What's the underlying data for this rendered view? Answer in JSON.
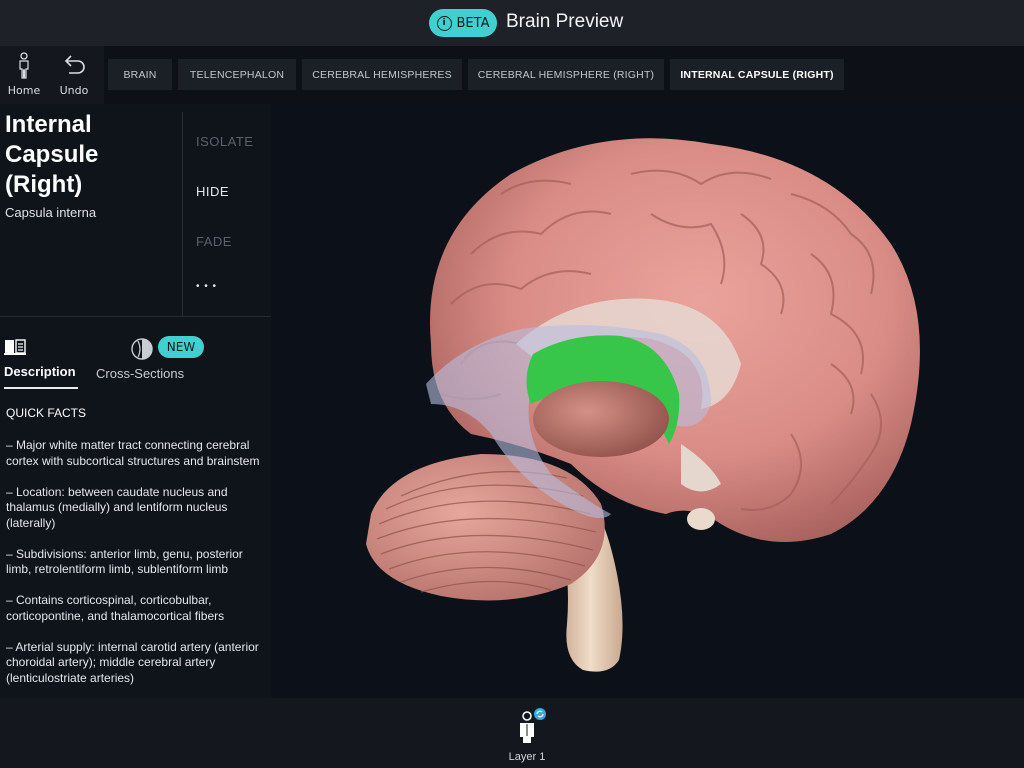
{
  "header": {
    "beta_label": "BETA",
    "title": "Brain Preview"
  },
  "tools": {
    "home_label": "Home",
    "undo_label": "Undo"
  },
  "breadcrumbs": [
    {
      "label": "BRAIN"
    },
    {
      "label": "TELENCEPHALON"
    },
    {
      "label": "CEREBRAL HEMISPHERES"
    },
    {
      "label": "CEREBRAL HEMISPHERE (RIGHT)"
    },
    {
      "label": "INTERNAL CAPSULE (RIGHT)",
      "active": true
    }
  ],
  "structure": {
    "title_line1": "Internal",
    "title_line2": "Capsule",
    "title_line3": "(Right)",
    "latin_name": "Capsula interna"
  },
  "actions": {
    "isolate": "ISOLATE",
    "hide": "HIDE",
    "fade": "FADE",
    "more": "• • •"
  },
  "tabs": {
    "description": "Description",
    "cross_sections": "Cross-Sections",
    "new_badge": "NEW"
  },
  "quick_facts": {
    "heading": "QUICK FACTS",
    "items": [
      "– Major white matter tract connecting cerebral cortex with subcortical structures and brainstem",
      "– Location: between caudate nucleus and thalamus (medially) and lentiform nucleus (laterally)",
      "– Subdivisions: anterior limb, genu, posterior limb, retrolentiform limb, sublentiform limb",
      "– Contains corticospinal, corticobulbar, corticopontine, and thalamocortical fibers",
      "– Arterial supply: internal carotid artery (anterior choroidal artery); middle cerebral artery (lenticulostriate arteries)"
    ]
  },
  "footer": {
    "layer_label": "Layer 1"
  },
  "colors": {
    "accent": "#3fd0cf",
    "highlight": "#37c64a",
    "cortex": "#d98c86",
    "background": "#0c1119"
  },
  "icons": {
    "beta": "info-icon",
    "home": "human-figure-icon",
    "undo": "undo-arrow-icon",
    "description": "book-icon",
    "cross_sections": "cross-section-icon",
    "layer": "body-layer-icon",
    "sync": "sync-icon"
  }
}
